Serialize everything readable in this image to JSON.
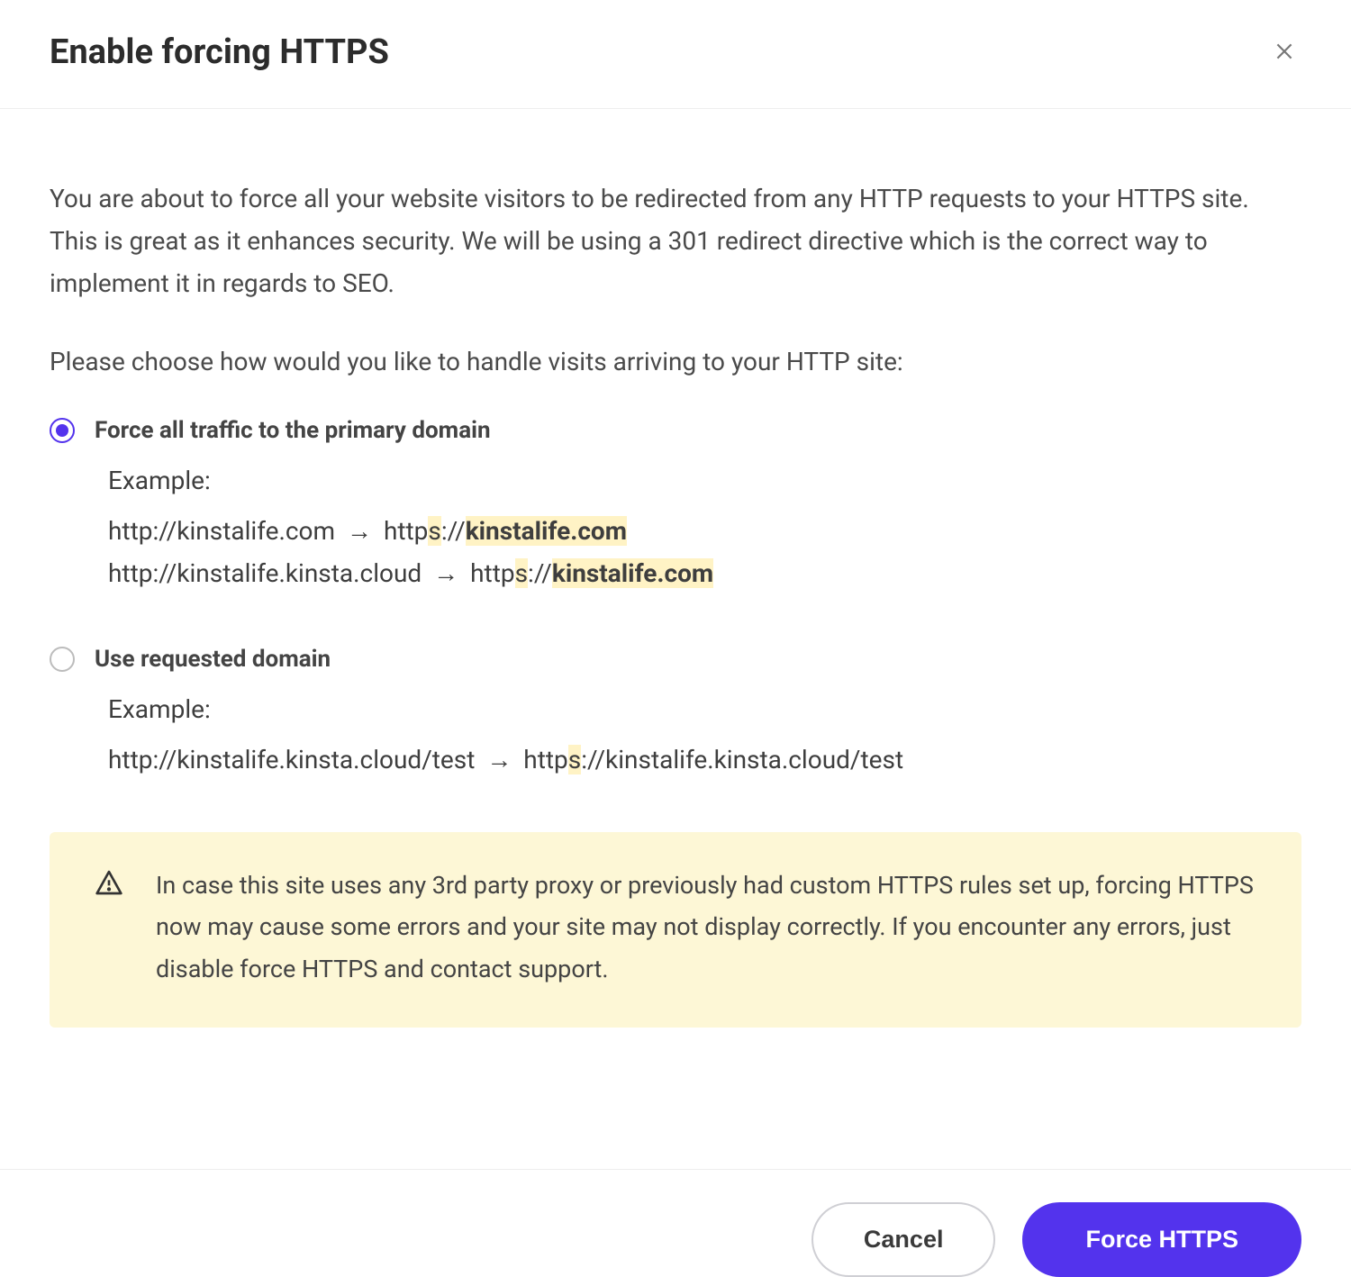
{
  "modal": {
    "title": "Enable forcing HTTPS",
    "intro": "You are about to force all your website visitors to be redirected from any HTTP requests to your HTTPS site. This is great as it enhances security. We will be using a 301 redirect directive which is the correct way to implement it in regards to SEO.",
    "choose": "Please choose how would you like to handle visits arriving to your HTTP site:",
    "options": {
      "primary": {
        "label": "Force all traffic to the primary domain",
        "selected": true,
        "example_heading": "Example:",
        "examples": [
          {
            "from": "http://kinstalife.com",
            "arrow": "→",
            "to_prefix": "http",
            "to_s": "s",
            "to_scheme_rest": "://",
            "to_host_bold": "kinstalife.com"
          },
          {
            "from": "http://kinstalife.kinsta.cloud",
            "arrow": "→",
            "to_prefix": "http",
            "to_s": "s",
            "to_scheme_rest": "://",
            "to_host_bold": "kinstalife.com"
          }
        ]
      },
      "requested": {
        "label": "Use requested domain",
        "selected": false,
        "example_heading": "Example:",
        "examples": [
          {
            "from": "http://kinstalife.kinsta.cloud/test",
            "arrow": "→",
            "to_prefix": "http",
            "to_s": "s",
            "to_rest": "://kinstalife.kinsta.cloud/test"
          }
        ]
      }
    },
    "warning": "In case this site uses any 3rd party proxy or previously had custom HTTPS rules set up, forcing HTTPS now may cause some errors and your site may not display correctly. If you encounter any errors, just disable force HTTPS and contact support.",
    "footer": {
      "cancel": "Cancel",
      "confirm": "Force HTTPS"
    }
  }
}
